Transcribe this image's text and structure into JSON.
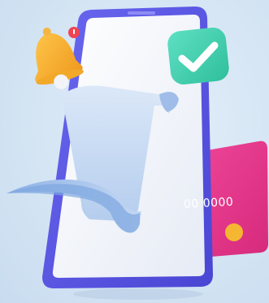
{
  "illustration": {
    "credit_card": {
      "number_fragment": "00 0000",
      "color": "#e8338b",
      "chip_color": "#f5b731"
    },
    "phone": {
      "frame_color": "#5a57e6",
      "screen_color": "#f4f6fb"
    },
    "receipt": {
      "color": "#bfd6f3"
    },
    "checkmark_badge": {
      "icon": "check-icon",
      "color": "#3fd3b1"
    },
    "notification_bell": {
      "icon": "bell-icon",
      "color": "#f6b233",
      "dot_color": "#ef4452"
    }
  }
}
